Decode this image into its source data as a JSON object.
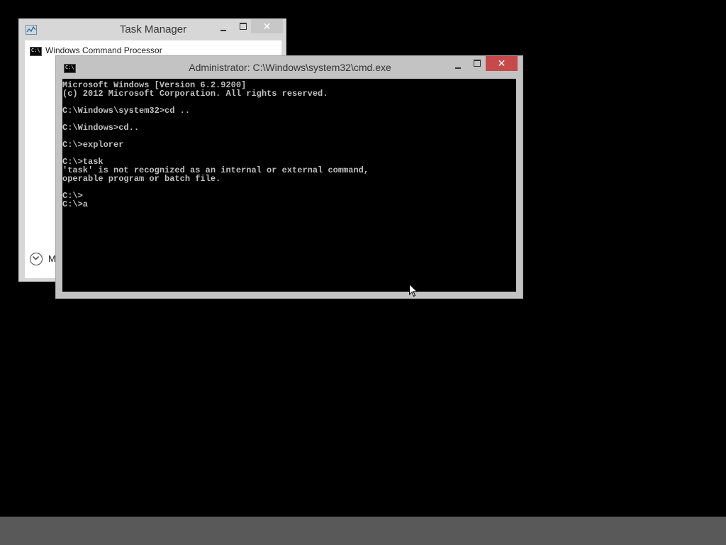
{
  "task_manager": {
    "title": "Task Manager",
    "minimize_glyph": "–",
    "close_glyph": "✕",
    "process_label": "Windows Command Processor",
    "more_details_label": "M",
    "icon": "task-manager-icon"
  },
  "cmd": {
    "title": "Administrator: C:\\Windows\\system32\\cmd.exe",
    "close_glyph": "✕",
    "icon_text": "C:\\",
    "lines": [
      "Microsoft Windows [Version 6.2.9200]",
      "(c) 2012 Microsoft Corporation. All rights reserved.",
      "",
      "C:\\Windows\\system32>cd ..",
      "",
      "C:\\Windows>cd..",
      "",
      "C:\\>explorer",
      "",
      "C:\\>task",
      "'task' is not recognized as an internal or external command,",
      "operable program or batch file.",
      "",
      "C:\\>",
      "C:\\>a"
    ]
  },
  "colors": {
    "desktop": "#000000",
    "taskbar": "#595959",
    "cmd_close": "#c74a4a",
    "console_text": "#c0c0c0"
  }
}
